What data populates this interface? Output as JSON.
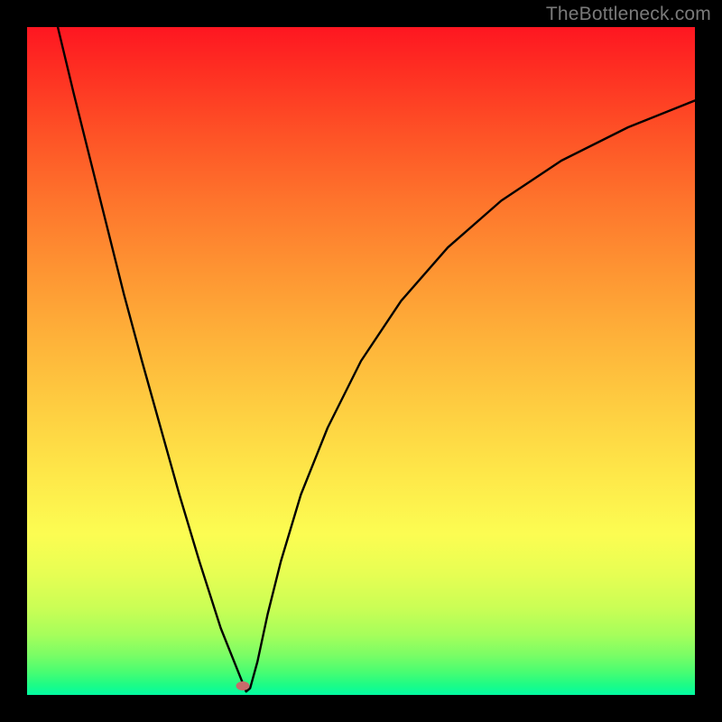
{
  "watermark": "TheBottleneck.com",
  "chart_data": {
    "type": "line",
    "title": "",
    "xlabel": "",
    "ylabel": "",
    "x_range": [
      0,
      1
    ],
    "y_range": [
      0,
      1
    ],
    "background_gradient_meaning": "vertical gradient red (top, high bottleneck) to green (bottom, low bottleneck)",
    "series": [
      {
        "name": "bottleneck-curve",
        "color": "#000000",
        "points": [
          {
            "x": 0.046,
            "y": 1.0
          },
          {
            "x": 0.07,
            "y": 0.9
          },
          {
            "x": 0.095,
            "y": 0.8
          },
          {
            "x": 0.12,
            "y": 0.7
          },
          {
            "x": 0.145,
            "y": 0.6
          },
          {
            "x": 0.172,
            "y": 0.5
          },
          {
            "x": 0.2,
            "y": 0.4
          },
          {
            "x": 0.228,
            "y": 0.3
          },
          {
            "x": 0.258,
            "y": 0.2
          },
          {
            "x": 0.29,
            "y": 0.1
          },
          {
            "x": 0.318,
            "y": 0.03
          },
          {
            "x": 0.328,
            "y": 0.005
          },
          {
            "x": 0.334,
            "y": 0.01
          },
          {
            "x": 0.345,
            "y": 0.05
          },
          {
            "x": 0.36,
            "y": 0.12
          },
          {
            "x": 0.38,
            "y": 0.2
          },
          {
            "x": 0.41,
            "y": 0.3
          },
          {
            "x": 0.45,
            "y": 0.4
          },
          {
            "x": 0.5,
            "y": 0.5
          },
          {
            "x": 0.56,
            "y": 0.59
          },
          {
            "x": 0.63,
            "y": 0.67
          },
          {
            "x": 0.71,
            "y": 0.74
          },
          {
            "x": 0.8,
            "y": 0.8
          },
          {
            "x": 0.9,
            "y": 0.85
          },
          {
            "x": 1.0,
            "y": 0.89
          }
        ]
      }
    ],
    "marker": {
      "x": 0.323,
      "y": 0.013,
      "color": "#c76b6b"
    }
  }
}
